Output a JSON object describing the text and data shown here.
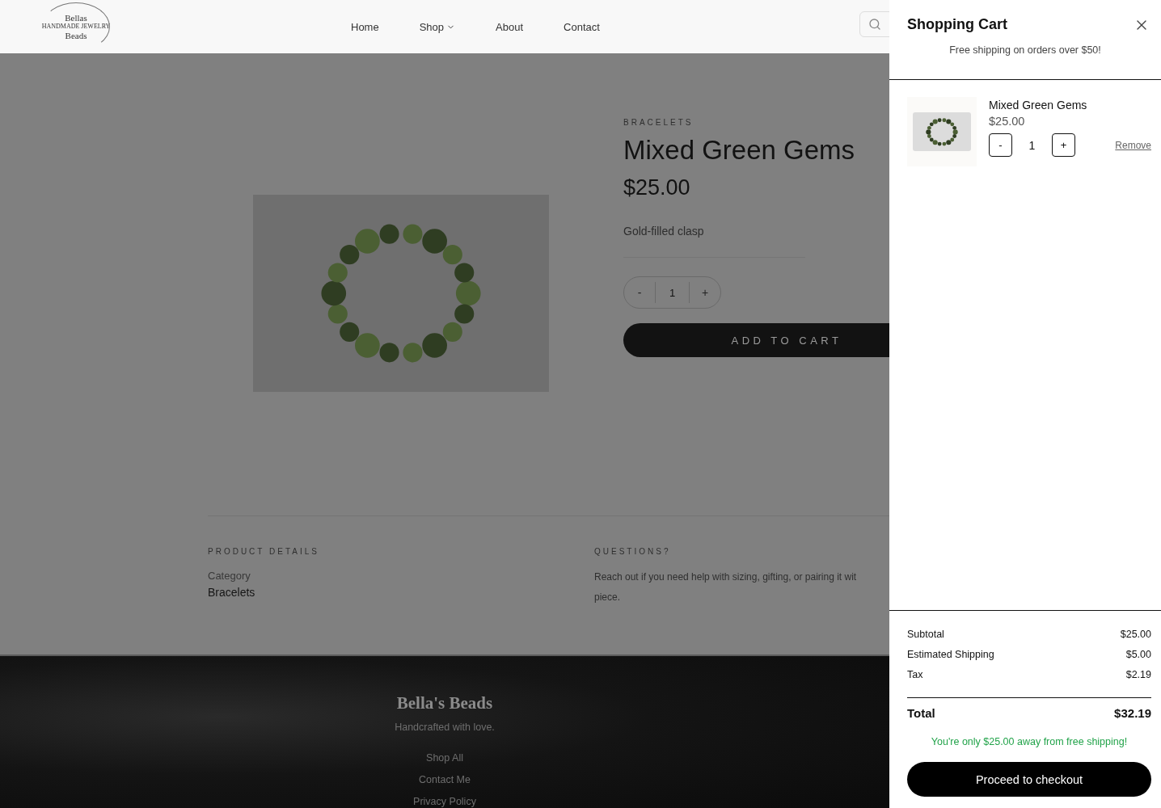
{
  "header": {
    "logo": {
      "lines": [
        "Bellas",
        "HANDMADE JEWELRY",
        "Beads"
      ]
    },
    "nav": [
      {
        "label": "Home",
        "has_menu": false
      },
      {
        "label": "Shop",
        "has_menu": true
      },
      {
        "label": "About",
        "has_menu": false
      },
      {
        "label": "Contact",
        "has_menu": false
      }
    ]
  },
  "product": {
    "category": "BRACELETS",
    "title": "Mixed Green Gems",
    "price": "$25.00",
    "description": "Gold-filled clasp",
    "quantity": {
      "minus": "-",
      "value": "1",
      "plus": "+"
    },
    "add_button": "ADD TO CART"
  },
  "details": {
    "product_details": {
      "heading": "PRODUCT DETAILS",
      "label": "Category",
      "value": "Bracelets"
    },
    "questions": {
      "heading": "QUESTIONS?",
      "lines": [
        "Reach out if you need help with sizing, gifting, or pairing it wit",
        "piece."
      ]
    }
  },
  "footer": {
    "brand": "Bella's Beads",
    "tagline": "Handcrafted with love.",
    "links": [
      "Shop All",
      "Contact Me",
      "Privacy Policy"
    ]
  },
  "cart": {
    "title": "Shopping Cart",
    "notice": "Free shipping on orders over $50!",
    "items": [
      {
        "name": "Mixed Green Gems",
        "price": "$25.00",
        "minus": "-",
        "quantity": "1",
        "plus": "+",
        "remove": "Remove"
      }
    ],
    "summary": [
      {
        "kind": "line",
        "label": "Subtotal",
        "value": "$25.00"
      },
      {
        "kind": "line",
        "label": "Estimated Shipping",
        "value": "$5.00"
      },
      {
        "kind": "line",
        "label": "Tax",
        "value": "$2.19"
      },
      {
        "kind": "total",
        "label": "Total",
        "value": "$32.19"
      }
    ],
    "shipping_message": "You're only $25.00 away from free shipping!",
    "checkout": "Proceed to checkout"
  }
}
